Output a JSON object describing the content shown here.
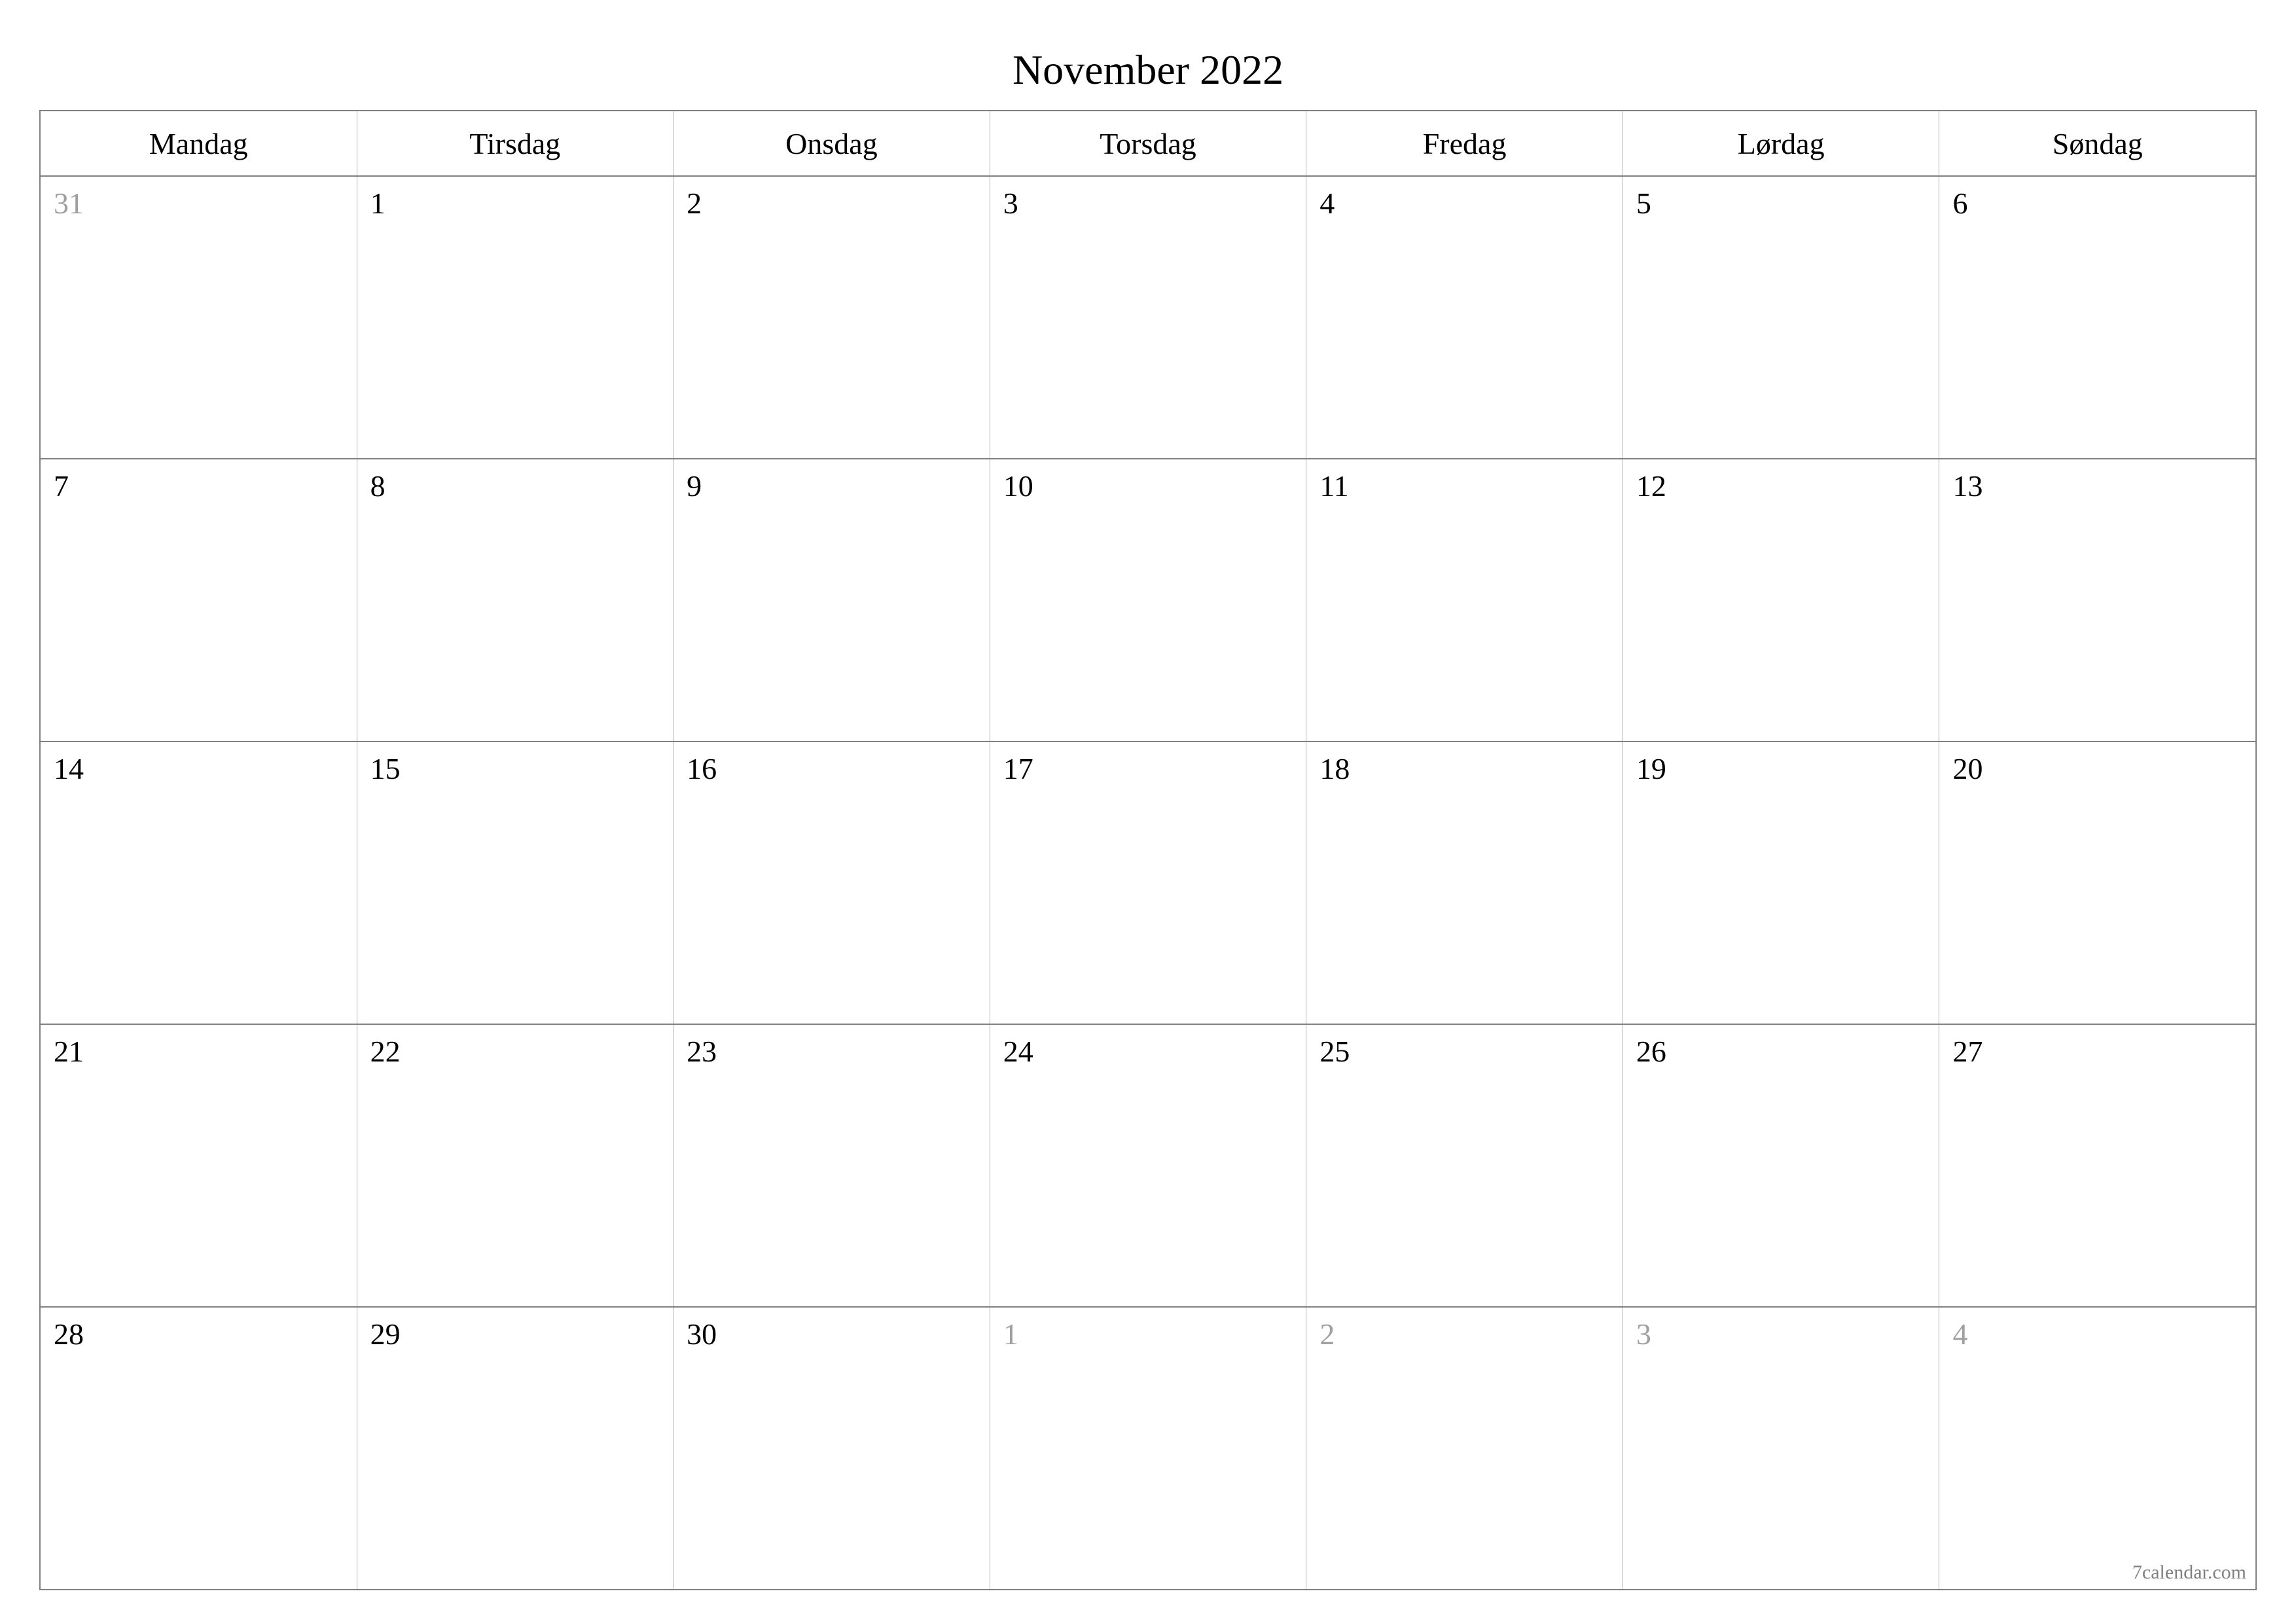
{
  "title": "November 2022",
  "weekdays": [
    "Mandag",
    "Tirsdag",
    "Onsdag",
    "Torsdag",
    "Fredag",
    "Lørdag",
    "Søndag"
  ],
  "weeks": [
    [
      {
        "n": "31",
        "other": true
      },
      {
        "n": "1",
        "other": false
      },
      {
        "n": "2",
        "other": false
      },
      {
        "n": "3",
        "other": false
      },
      {
        "n": "4",
        "other": false
      },
      {
        "n": "5",
        "other": false
      },
      {
        "n": "6",
        "other": false
      }
    ],
    [
      {
        "n": "7",
        "other": false
      },
      {
        "n": "8",
        "other": false
      },
      {
        "n": "9",
        "other": false
      },
      {
        "n": "10",
        "other": false
      },
      {
        "n": "11",
        "other": false
      },
      {
        "n": "12",
        "other": false
      },
      {
        "n": "13",
        "other": false
      }
    ],
    [
      {
        "n": "14",
        "other": false
      },
      {
        "n": "15",
        "other": false
      },
      {
        "n": "16",
        "other": false
      },
      {
        "n": "17",
        "other": false
      },
      {
        "n": "18",
        "other": false
      },
      {
        "n": "19",
        "other": false
      },
      {
        "n": "20",
        "other": false
      }
    ],
    [
      {
        "n": "21",
        "other": false
      },
      {
        "n": "22",
        "other": false
      },
      {
        "n": "23",
        "other": false
      },
      {
        "n": "24",
        "other": false
      },
      {
        "n": "25",
        "other": false
      },
      {
        "n": "26",
        "other": false
      },
      {
        "n": "27",
        "other": false
      }
    ],
    [
      {
        "n": "28",
        "other": false
      },
      {
        "n": "29",
        "other": false
      },
      {
        "n": "30",
        "other": false
      },
      {
        "n": "1",
        "other": true
      },
      {
        "n": "2",
        "other": true
      },
      {
        "n": "3",
        "other": true
      },
      {
        "n": "4",
        "other": true
      }
    ]
  ],
  "footer": "7calendar.com"
}
